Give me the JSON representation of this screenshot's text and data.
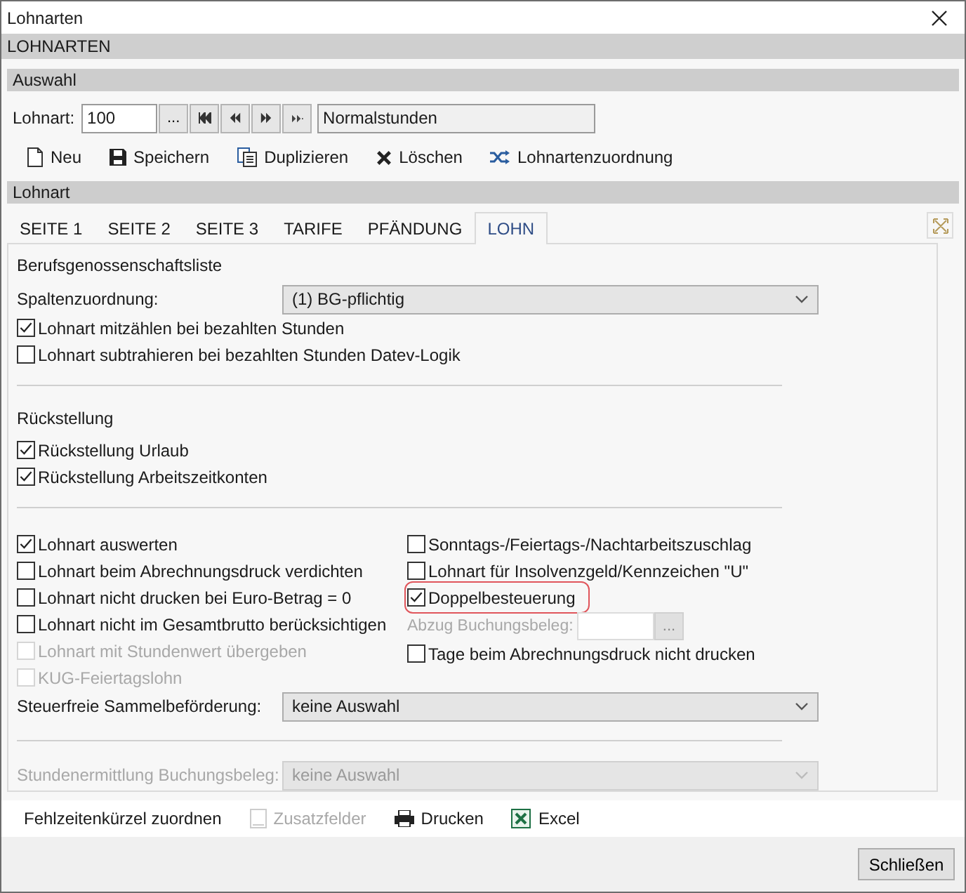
{
  "window": {
    "title": "Lohnarten"
  },
  "header": "LOHNARTEN",
  "selection": {
    "title": "Auswahl",
    "label": "Lohnart:",
    "value": "100",
    "browse": "...",
    "name_value": "Normalstunden"
  },
  "toolbar": [
    {
      "kind": "new",
      "label": "Neu"
    },
    {
      "kind": "save",
      "label": "Speichern"
    },
    {
      "kind": "duplicate",
      "label": "Duplizieren"
    },
    {
      "kind": "delete",
      "label": "Löschen"
    },
    {
      "kind": "shuffle",
      "label": "Lohnartenzuordnung"
    }
  ],
  "section": {
    "title": "Lohnart"
  },
  "tabs": [
    {
      "label": "SEITE 1",
      "selected": false
    },
    {
      "label": "SEITE 2",
      "selected": false
    },
    {
      "label": "SEITE 3",
      "selected": false
    },
    {
      "label": "TARIFE",
      "selected": false
    },
    {
      "label": "PFÄNDUNG",
      "selected": false
    },
    {
      "label": "LOHN",
      "selected": true
    }
  ],
  "bg": {
    "title": "Berufsgenossenschaftsliste",
    "select_label": "Spaltenzuordnung:",
    "select_value": "(1) BG-pflichtig",
    "options": [
      {
        "label": "Lohnart mitzählen bei bezahlten Stunden",
        "checked": true
      },
      {
        "label": "Lohnart subtrahieren bei bezahlten Stunden Datev-Logik",
        "checked": false
      }
    ]
  },
  "provision": {
    "title": "Rückstellung",
    "options": [
      {
        "label": "Rückstellung Urlaub",
        "checked": true
      },
      {
        "label": "Rückstellung Arbeitszeitkonten",
        "checked": true
      }
    ]
  },
  "left_options": [
    {
      "label": "Lohnart auswerten",
      "checked": true,
      "disabled": false
    },
    {
      "label": "Lohnart beim Abrechnungsdruck verdichten",
      "checked": false,
      "disabled": false
    },
    {
      "label": "Lohnart nicht drucken bei Euro-Betrag = 0",
      "checked": false,
      "disabled": false
    },
    {
      "label": "Lohnart nicht im Gesamtbrutto berücksichtigen",
      "checked": false,
      "disabled": false
    },
    {
      "label": "Lohnart mit Stundenwert übergeben",
      "checked": false,
      "disabled": true
    },
    {
      "label": "KUG-Feiertagslohn",
      "checked": false,
      "disabled": true
    }
  ],
  "right_options": [
    {
      "kind": "checkbox",
      "label": "Sonntags-/Feiertags-/Nachtarbeitszuschlag",
      "checked": false,
      "highlighted": false
    },
    {
      "kind": "checkbox",
      "label": "Lohnart für Insolvenzgeld/Kennzeichen \"U\"",
      "checked": false,
      "highlighted": false
    },
    {
      "kind": "checkbox",
      "label": "Doppelbesteuerung",
      "checked": true,
      "highlighted": true
    },
    {
      "kind": "field",
      "label": "Abzug Buchungsbeleg:",
      "button": "...",
      "disabled": true
    },
    {
      "kind": "checkbox",
      "label": "Tage beim Abrechnungsdruck nicht drucken",
      "checked": false,
      "highlighted": false
    }
  ],
  "transport": {
    "label": "Steuerfreie Sammelbeförderung:",
    "value": "keine Auswahl",
    "disabled": false
  },
  "hours": {
    "label": "Stundenermittlung Buchungsbeleg:",
    "value": "keine Auswahl",
    "disabled": true
  },
  "bottom_toolbar": [
    {
      "kind": "text",
      "label": "Fehlzeitenkürzel zuordnen",
      "disabled": false
    },
    {
      "kind": "fields",
      "label": "Zusatzfelder",
      "disabled": true
    },
    {
      "kind": "print",
      "label": "Drucken",
      "disabled": false
    },
    {
      "kind": "excel",
      "label": "Excel",
      "disabled": false
    }
  ],
  "close_button": "Schließen"
}
